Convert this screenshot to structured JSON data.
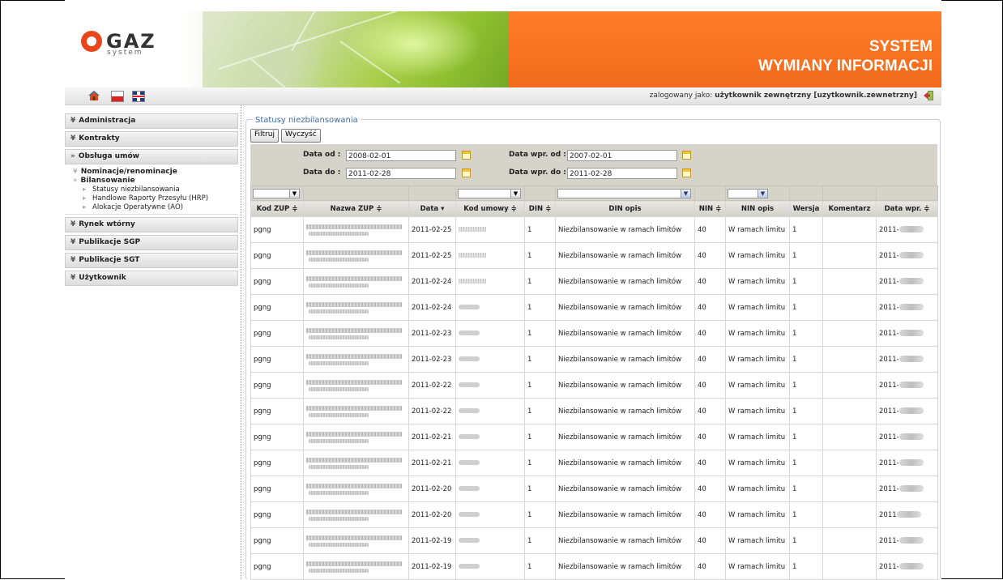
{
  "header": {
    "logo_text": "GAZ",
    "logo_sub": "system",
    "title_line1": "SYSTEM",
    "title_line2": "WYMIANY INFORMACJI"
  },
  "topbar": {
    "logged_prefix": "zalogowany jako:",
    "logged_user": "użytkownik zewnętrzny [uzytkownik.zewnetrzny]"
  },
  "sidebar": {
    "administracja": "Administracja",
    "kontrakty": "Kontrakty",
    "obsluga": "Obsługa umów",
    "nominacje": "Nominacje/renominacje",
    "bilansowanie": "Bilansowanie",
    "statusy": "Statusy niezbilansowania",
    "hrp": "Handlowe Raporty Przesyłu (HRP)",
    "ao": "Alokacje Operatywne (AO)",
    "rynek": "Rynek wtórny",
    "sgp": "Publikacje SGP",
    "sgt": "Publikacje SGT",
    "uzytkownik": "Użytkownik"
  },
  "panel": {
    "legend": "Statusy niezbilansowania",
    "filter_btn": "Filtruj",
    "clear_btn": "Wyczyść"
  },
  "filters": {
    "data_od_label": "Data od :",
    "data_od": "2008-02-01",
    "data_do_label": "Data do :",
    "data_do": "2011-02-28",
    "wpr_od_label": "Data wpr. od :",
    "wpr_od": "2007-02-01",
    "wpr_do_label": "Data wpr. do :",
    "wpr_do": "2011-02-28"
  },
  "table": {
    "headers": {
      "kod_zup": "Kod ZUP ≑",
      "nazwa_zup": "Nazwa ZUP ≑",
      "data": "Data ▾",
      "kod_umowy": "Kod umowy ≑",
      "din": "DIN ≑",
      "din_opis": "DIN opis",
      "nin": "NIN ≑",
      "nin_opis": "NIN opis",
      "wersja": "Wersja",
      "komentarz": "Komentarz",
      "data_wpr": "Data wpr. ≑"
    },
    "rows": [
      {
        "kod": "pgng",
        "data": "2011-02-25",
        "din": "1",
        "din_opis": "Niezbilansowanie w ramach limitów",
        "nin": "40",
        "nin_opis": "W ramach limitu",
        "wersja": "1",
        "wpr": "2011-"
      },
      {
        "kod": "pgng",
        "data": "2011-02-25",
        "din": "1",
        "din_opis": "Niezbilansowanie w ramach limitów",
        "nin": "40",
        "nin_opis": "W ramach limitu",
        "wersja": "1",
        "wpr": "2011-"
      },
      {
        "kod": "pgng",
        "data": "2011-02-24",
        "din": "1",
        "din_opis": "Niezbilansowanie w ramach limitów",
        "nin": "40",
        "nin_opis": "W ramach limitu",
        "wersja": "1",
        "wpr": "2011-"
      },
      {
        "kod": "pgng",
        "data": "2011-02-24",
        "din": "1",
        "din_opis": "Niezbilansowanie w ramach limitów",
        "nin": "40",
        "nin_opis": "W ramach limitu",
        "wersja": "1",
        "wpr": "2011-"
      },
      {
        "kod": "pgng",
        "data": "2011-02-23",
        "din": "1",
        "din_opis": "Niezbilansowanie w ramach limitów",
        "nin": "40",
        "nin_opis": "W ramach limitu",
        "wersja": "1",
        "wpr": "2011-"
      },
      {
        "kod": "pgng",
        "data": "2011-02-23",
        "din": "1",
        "din_opis": "Niezbilansowanie w ramach limitów",
        "nin": "40",
        "nin_opis": "W ramach limitu",
        "wersja": "1",
        "wpr": "2011-"
      },
      {
        "kod": "pgng",
        "data": "2011-02-22",
        "din": "1",
        "din_opis": "Niezbilansowanie w ramach limitów",
        "nin": "40",
        "nin_opis": "W ramach limitu",
        "wersja": "1",
        "wpr": "2011-"
      },
      {
        "kod": "pgng",
        "data": "2011-02-22",
        "din": "1",
        "din_opis": "Niezbilansowanie w ramach limitów",
        "nin": "40",
        "nin_opis": "W ramach limitu",
        "wersja": "1",
        "wpr": "2011-"
      },
      {
        "kod": "pgng",
        "data": "2011-02-21",
        "din": "1",
        "din_opis": "Niezbilansowanie w ramach limitów",
        "nin": "40",
        "nin_opis": "W ramach limitu",
        "wersja": "1",
        "wpr": "2011-"
      },
      {
        "kod": "pgng",
        "data": "2011-02-21",
        "din": "1",
        "din_opis": "Niezbilansowanie w ramach limitów",
        "nin": "40",
        "nin_opis": "W ramach limitu",
        "wersja": "1",
        "wpr": "2011-"
      },
      {
        "kod": "pgng",
        "data": "2011-02-20",
        "din": "1",
        "din_opis": "Niezbilansowanie w ramach limitów",
        "nin": "40",
        "nin_opis": "W ramach limitu",
        "wersja": "1",
        "wpr": "2011-"
      },
      {
        "kod": "pgng",
        "data": "2011-02-20",
        "din": "1",
        "din_opis": "Niezbilansowanie w ramach limitów",
        "nin": "40",
        "nin_opis": "W ramach limitu",
        "wersja": "1",
        "wpr": "2011"
      },
      {
        "kod": "pgng",
        "data": "2011-02-19",
        "din": "1",
        "din_opis": "Niezbilansowanie w ramach limitów",
        "nin": "40",
        "nin_opis": "W ramach limitu",
        "wersja": "1",
        "wpr": "2011-"
      },
      {
        "kod": "pgng",
        "data": "2011-02-19",
        "din": "1",
        "din_opis": "Niezbilansowanie w ramach limitów",
        "nin": "40",
        "nin_opis": "W ramach limitu",
        "wersja": "1",
        "wpr": "2011-"
      }
    ]
  },
  "icons": {
    "home": "home-icon",
    "flag_pl": "flag-pl-icon",
    "flag_uk": "flag-uk-icon",
    "calendar": "calendar-icon",
    "logout": "logout-icon",
    "dropdown": "chevron-down-icon"
  },
  "colors": {
    "orange_header": "#f26a1b",
    "legend_blue": "#3c6aa8",
    "filter_bg": "#d6d3cb"
  }
}
